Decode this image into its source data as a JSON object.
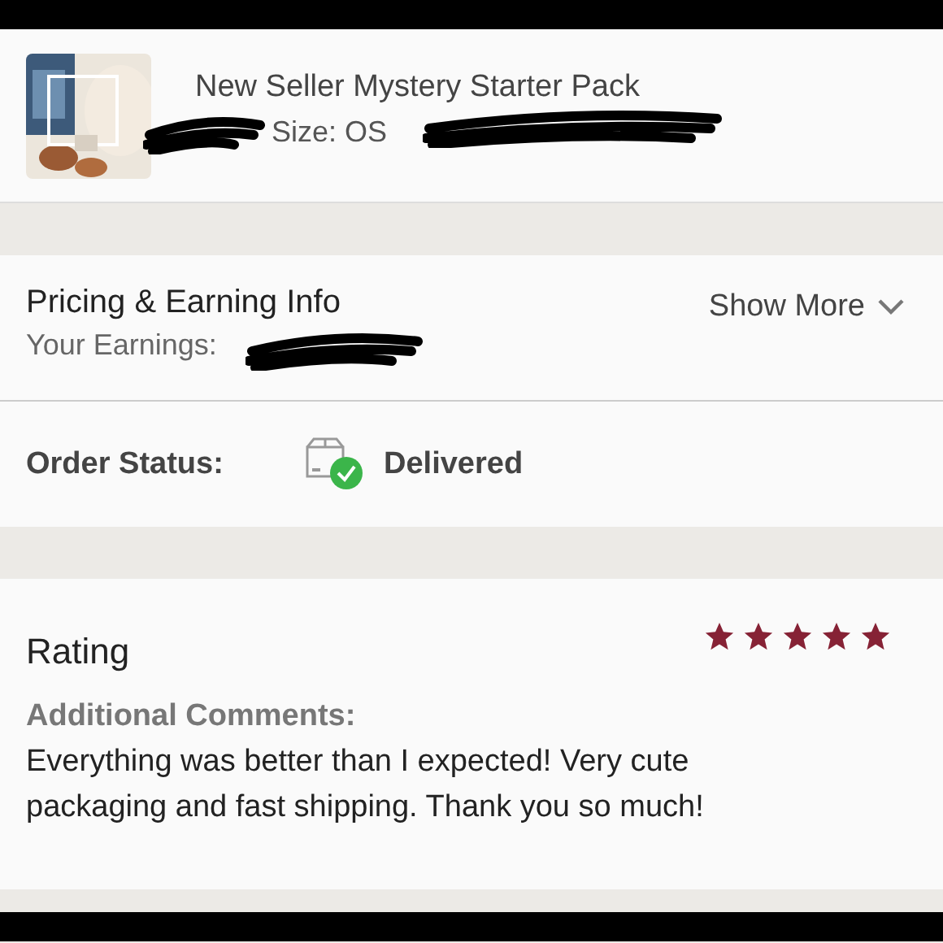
{
  "product": {
    "title": "New Seller Mystery Starter Pack",
    "size": "Size: OS"
  },
  "pricing": {
    "title": "Pricing & Earning Info",
    "earnings_label": "Your Earnings:",
    "toggle": "Show More"
  },
  "order_status": {
    "label": "Order Status:",
    "status": "Delivered"
  },
  "rating": {
    "title": "Rating",
    "stars": 5,
    "comments_label": "Additional Comments:",
    "comment": "Everything was better than I expected! Very cute packaging and fast shipping. Thank you so much!"
  }
}
